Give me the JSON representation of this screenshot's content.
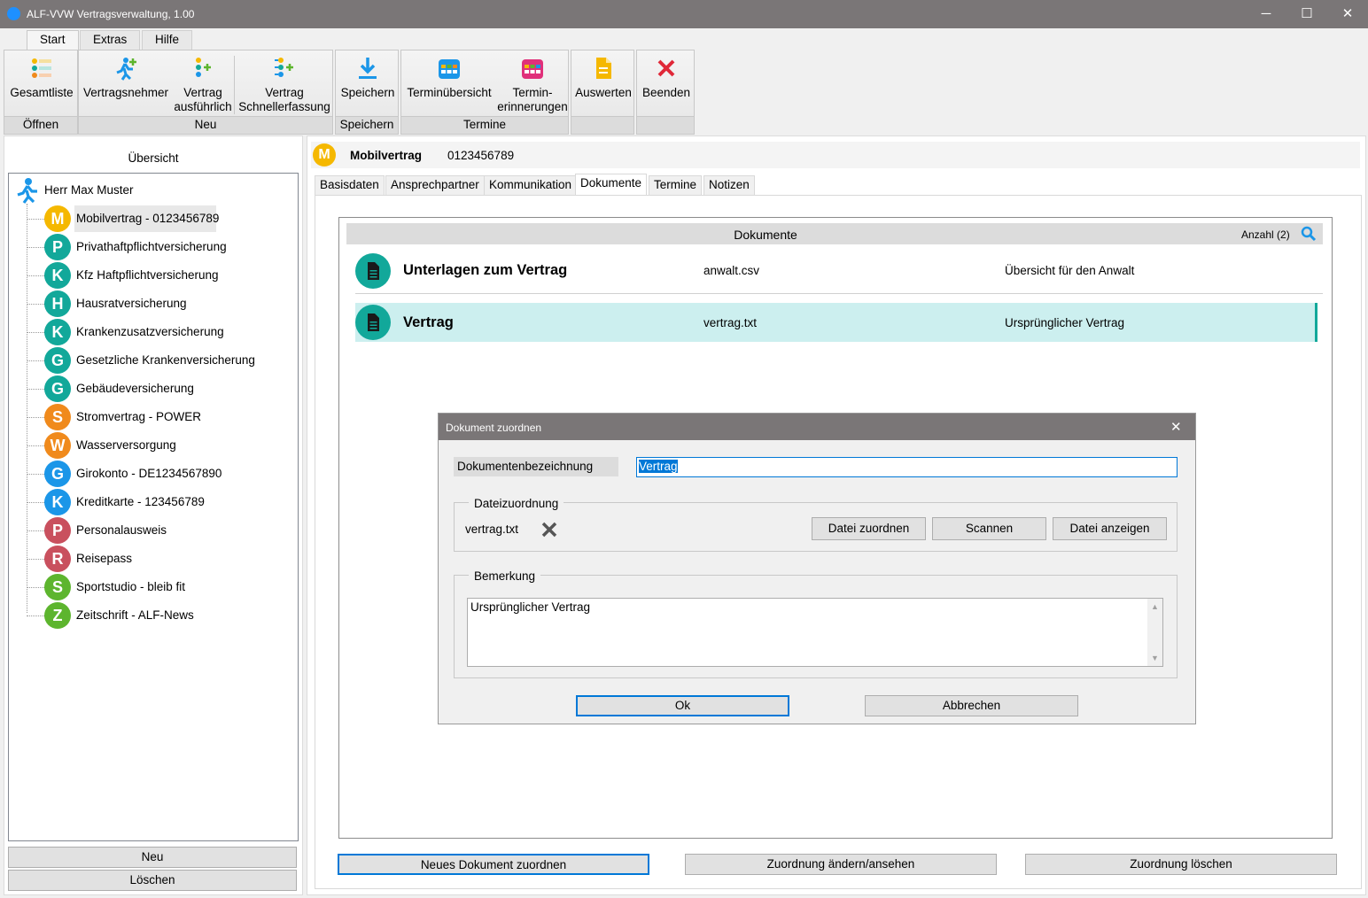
{
  "window": {
    "title": "ALF-VVW Vertragsverwaltung, 1.00",
    "minimize": "─",
    "maximize": "☐",
    "close": "✕"
  },
  "ribbon_tabs": [
    "Start",
    "Extras",
    "Hilfe"
  ],
  "ribbon": {
    "groups": [
      "Öffnen",
      "Neu",
      "Speichern",
      "Termine",
      ""
    ],
    "gesamtliste": "Gesamtliste",
    "vertragsnehmer": "Vertragsnehmer",
    "vertrag_ausfuehrlich_1": "Vertrag",
    "vertrag_ausfuehrlich_2": "ausführlich",
    "schnell_1": "Vertrag",
    "schnell_2": "Schnellerfassung",
    "speichern": "Speichern",
    "termin_uebersicht": "Terminübersicht",
    "termin_erinn_1": "Termin-",
    "termin_erinn_2": "erinnerungen",
    "auswerten": "Auswerten",
    "beenden": "Beenden"
  },
  "left": {
    "title": "Übersicht",
    "person": "Herr Max Muster",
    "items": [
      {
        "letter": "M",
        "label": "Mobilvertrag - 0123456789",
        "color": "#f5b800"
      },
      {
        "letter": "P",
        "label": "Privathaftpflichtversicherung",
        "color": "#12a89a"
      },
      {
        "letter": "K",
        "label": "Kfz Haftpflichtversicherung",
        "color": "#12a89a"
      },
      {
        "letter": "H",
        "label": "Hausratversicherung",
        "color": "#12a89a"
      },
      {
        "letter": "K",
        "label": "Krankenzusatzversicherung",
        "color": "#12a89a"
      },
      {
        "letter": "G",
        "label": "Gesetzliche Krankenversicherung",
        "color": "#12a89a"
      },
      {
        "letter": "G",
        "label": "Gebäudeversicherung",
        "color": "#12a89a"
      },
      {
        "letter": "S",
        "label": "Stromvertrag - POWER",
        "color": "#f08a1c"
      },
      {
        "letter": "W",
        "label": "Wasserversorgung",
        "color": "#f08a1c"
      },
      {
        "letter": "G",
        "label": "Girokonto - DE1234567890",
        "color": "#1b96e8"
      },
      {
        "letter": "K",
        "label": "Kreditkarte - 123456789",
        "color": "#1b96e8"
      },
      {
        "letter": "P",
        "label": "Personalausweis",
        "color": "#c9505e"
      },
      {
        "letter": "R",
        "label": "Reisepass",
        "color": "#c9505e"
      },
      {
        "letter": "S",
        "label": "Sportstudio - bleib fit",
        "color": "#5db52e"
      },
      {
        "letter": "Z",
        "label": "Zeitschrift - ALF-News",
        "color": "#5db52e"
      }
    ],
    "btn_new": "Neu",
    "btn_delete": "Löschen"
  },
  "header": {
    "letter": "M",
    "name": "Mobilvertrag",
    "number": "0123456789"
  },
  "content_tabs": [
    "Basisdaten",
    "Ansprechpartner",
    "Kommunikation",
    "Dokumente",
    "Termine",
    "Notizen"
  ],
  "documents": {
    "title": "Dokumente",
    "count": "Anzahl (2)",
    "rows": [
      {
        "name": "Unterlagen zum Vertrag",
        "file": "anwalt.csv",
        "note": "Übersicht für den Anwalt"
      },
      {
        "name": "Vertrag",
        "file": "vertrag.txt",
        "note": "Ursprünglicher Vertrag"
      }
    ]
  },
  "dialog": {
    "title": "Dokument zuordnen",
    "close": "✕",
    "label_name": "Dokumentenbezeichnung",
    "value_name": "Vertrag",
    "group_file": "Dateizuordnung",
    "file": "vertrag.txt",
    "btn_assign": "Datei zuordnen",
    "btn_scan": "Scannen",
    "btn_show": "Datei anzeigen",
    "group_remark": "Bemerkung",
    "remark": "Ursprünglicher Vertrag",
    "btn_ok": "Ok",
    "btn_cancel": "Abbrechen"
  },
  "bottom": {
    "btn_new": "Neues Dokument zuordnen",
    "btn_change": "Zuordnung ändern/ansehen",
    "btn_delete": "Zuordnung löschen"
  }
}
